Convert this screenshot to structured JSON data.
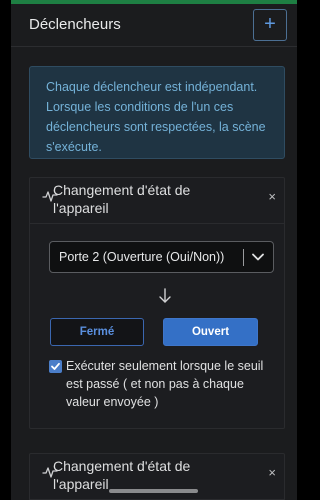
{
  "header": {
    "title": "Déclencheurs",
    "add_label": "+"
  },
  "info": {
    "text": "Chaque déclencheur est indépendant. Lorsque les conditions de l'un ces déclencheurs sont respectées, la scène s'exécute."
  },
  "triggers": [
    {
      "title": "Changement d'état de l'appareil",
      "close": "×",
      "select_value": "Porte 2 (Ouverture (Oui/Non))",
      "buttons": {
        "ferme": "Fermé",
        "ouvert": "Ouvert",
        "selected": "Ouvert"
      },
      "checkbox": {
        "checked": true,
        "label": "Exécuter seulement lorsque le seuil est passé ( et non pas à chaque valeur envoyée )"
      }
    },
    {
      "title": "Changement d'état de l'appareil",
      "close": "×"
    }
  ],
  "icons": [
    "plus-icon",
    "activity-icon",
    "close-icon",
    "chevron-down-icon",
    "arrow-down-icon",
    "checkmark-icon"
  ],
  "colors": {
    "accent": "#3470c6",
    "info_text": "#74b2d8",
    "info_bg": "#1f3443",
    "top_bar": "#1e7f43"
  }
}
